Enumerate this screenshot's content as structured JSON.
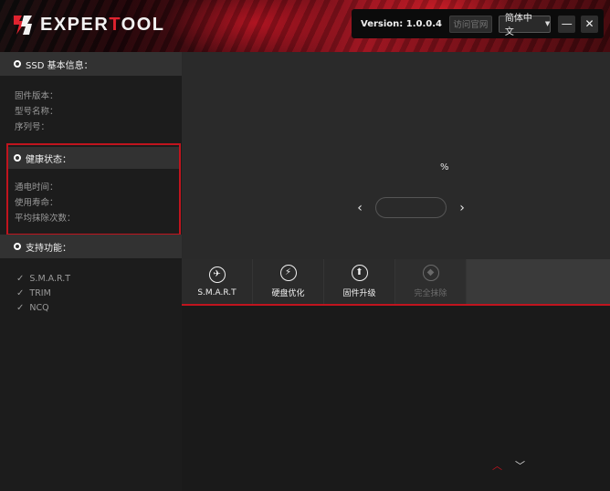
{
  "app": {
    "logo_pre": "EXPER",
    "logo_red": "T",
    "logo_post": "OOL",
    "version": "Version: 1.0.0.4",
    "visit_button": "访问官网",
    "language": "简体中文",
    "minimize": "—",
    "close": "✕"
  },
  "sidebar": {
    "ssd_title": "SSD 基本信息：",
    "ssd_rows": [
      "固件版本：",
      "型号名称：",
      "序列号："
    ],
    "health_title": "健康状态：",
    "health_rows": [
      "通电时间：",
      "使用寿命：",
      "平均抹除次数："
    ],
    "features_title": "支持功能：",
    "features": [
      "S.M.A.R.T",
      "TRIM",
      "NCQ"
    ]
  },
  "gauge": {
    "percent_sign": "%"
  },
  "tabs": [
    {
      "label": "S.M.A.R.T",
      "icon": "airplane-icon"
    },
    {
      "label": "硬盘优化",
      "icon": "lightning-icon"
    },
    {
      "label": "固件升级",
      "icon": "upload-arrow-icon"
    },
    {
      "label": "完全抹除",
      "icon": "eraser-icon"
    }
  ],
  "colors": {
    "accent": "#c0141e"
  }
}
